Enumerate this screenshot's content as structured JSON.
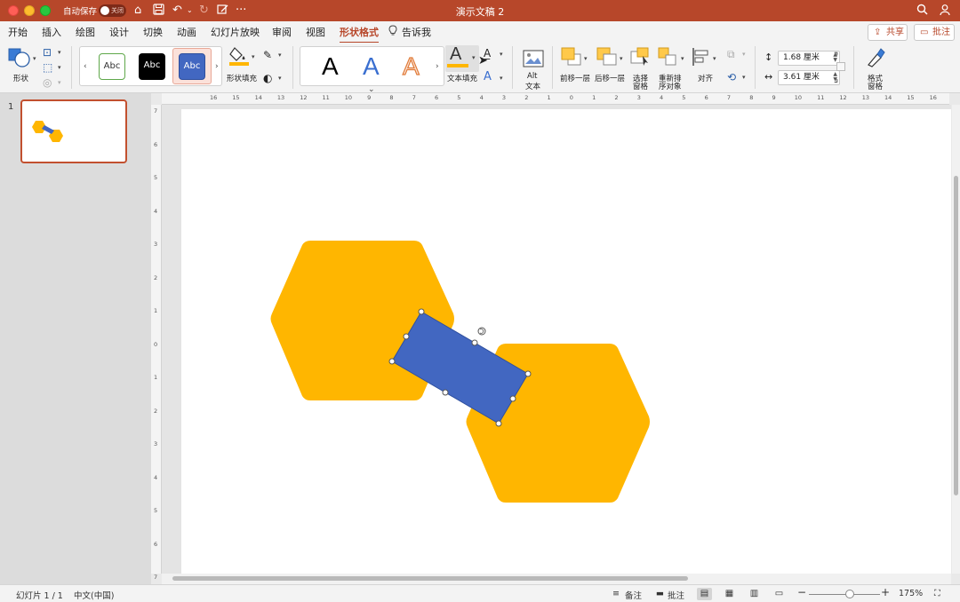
{
  "titlebar": {
    "autosave_label": "自动保存",
    "toggle_state": "关闭",
    "title": "演示文稿 2"
  },
  "tabs": [
    {
      "label": "开始"
    },
    {
      "label": "插入"
    },
    {
      "label": "绘图"
    },
    {
      "label": "设计"
    },
    {
      "label": "切换"
    },
    {
      "label": "动画"
    },
    {
      "label": "幻灯片放映"
    },
    {
      "label": "审阅"
    },
    {
      "label": "视图"
    },
    {
      "label": "形状格式"
    },
    {
      "label": "告诉我"
    }
  ],
  "actions": {
    "share": "共享",
    "comment": "批注"
  },
  "ribbon": {
    "shapes_label": "形状",
    "style_gallery": [
      "Abc",
      "Abc",
      "Abc"
    ],
    "shape_fill_label": "形状填充",
    "wordart_gallery": [
      "A",
      "A",
      "A"
    ],
    "text_fill_label": "文本填充",
    "alt_text_label_line1": "Alt",
    "alt_text_label_line2": "文本",
    "bring_forward_label": "前移一层",
    "send_backward_label": "后移一层",
    "selection_pane_line1": "选择",
    "selection_pane_line2": "窗格",
    "reorder_line1": "重新排",
    "reorder_line2": "序对象",
    "align_label": "对齐",
    "height_value": "1.68 厘米",
    "width_value": "3.61 厘米",
    "format_pane_line1": "格式",
    "format_pane_line2": "窗格"
  },
  "slides_panel": {
    "slide_number": "1"
  },
  "ruler": {
    "h_labels": [
      "16",
      "15",
      "14",
      "13",
      "12",
      "11",
      "10",
      "9",
      "8",
      "7",
      "6",
      "5",
      "4",
      "3",
      "2",
      "1",
      "0",
      "1",
      "2",
      "3",
      "4",
      "5",
      "6",
      "7",
      "8",
      "9",
      "10",
      "11",
      "12",
      "13",
      "14",
      "15",
      "16"
    ],
    "v_labels": [
      "7",
      "6",
      "5",
      "4",
      "3",
      "2",
      "1",
      "0",
      "1",
      "2",
      "3",
      "4",
      "5",
      "6",
      "7"
    ]
  },
  "statusbar": {
    "slide_info": "幻灯片 1 / 1",
    "language": "中文(中国)",
    "notes": "备注",
    "comments": "批注",
    "zoom": "175%"
  },
  "colors": {
    "accent": "#b7472a",
    "hexagon_fill": "#ffb600",
    "rectangle_fill": "#4267c1"
  }
}
